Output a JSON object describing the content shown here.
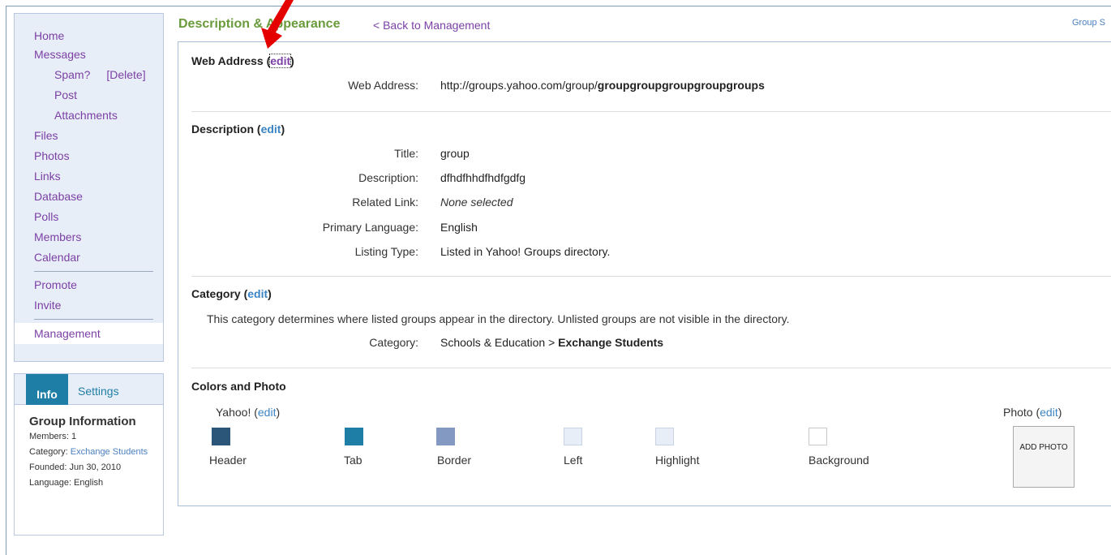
{
  "nav": {
    "home": "Home",
    "messages": "Messages",
    "spam": "Spam?",
    "delete": "[Delete]",
    "post": "Post",
    "attachments": "Attachments",
    "files": "Files",
    "photos": "Photos",
    "links": "Links",
    "database": "Database",
    "polls": "Polls",
    "members": "Members",
    "calendar": "Calendar",
    "promote": "Promote",
    "invite": "Invite",
    "management": "Management"
  },
  "info": {
    "tab_info": "Info",
    "tab_settings": "Settings",
    "heading": "Group Information",
    "members": "Members: 1",
    "category_label": "Category: ",
    "category_link": "Exchange Students",
    "founded": "Founded: Jun 30, 2010",
    "language": "Language: English"
  },
  "header": {
    "title": "Description & Appearance",
    "back": "< Back to Management",
    "group_s": "Group S"
  },
  "web_address": {
    "heading": "Web Address (",
    "edit": "edit",
    "close": ")",
    "label": "Web Address:",
    "url_prefix": "http://groups.yahoo.com/group/",
    "url_name": "groupgroupgroupgroupgroups"
  },
  "description": {
    "heading": "Description (",
    "edit": "edit",
    "close": ")",
    "title_label": "Title:",
    "title_value": "group",
    "desc_label": "Description:",
    "desc_value": "dfhdfhhdfhdfgdfg",
    "related_label": "Related Link:",
    "related_value": "None selected",
    "lang_label": "Primary Language:",
    "lang_value": "English",
    "listing_label": "Listing Type:",
    "listing_value": "Listed in Yahoo! Groups directory."
  },
  "category": {
    "heading": "Category (",
    "edit": "edit",
    "close": ")",
    "note": "This category determines where listed groups appear in the directory. Unlisted groups are not visible in the directory.",
    "label": "Category:",
    "path": "Schools & Education > ",
    "leaf": "Exchange Students"
  },
  "colors": {
    "heading": "Colors and Photo",
    "yahoo": "Yahoo! (",
    "edit": "edit",
    "close": ")",
    "photo": "Photo  (",
    "photo_edit": "edit",
    "photo_close": ")",
    "add_photo": "ADD PHOTO",
    "swatches": [
      {
        "name": "Header",
        "color": "#2b5679"
      },
      {
        "name": "Tab",
        "color": "#1e7ea5"
      },
      {
        "name": "Border",
        "color": "#8499c2"
      },
      {
        "name": "Left",
        "color": "#e8eef7"
      },
      {
        "name": "Highlight",
        "color": "#e8eef7"
      },
      {
        "name": "Background",
        "color": "#ffffff"
      }
    ]
  }
}
